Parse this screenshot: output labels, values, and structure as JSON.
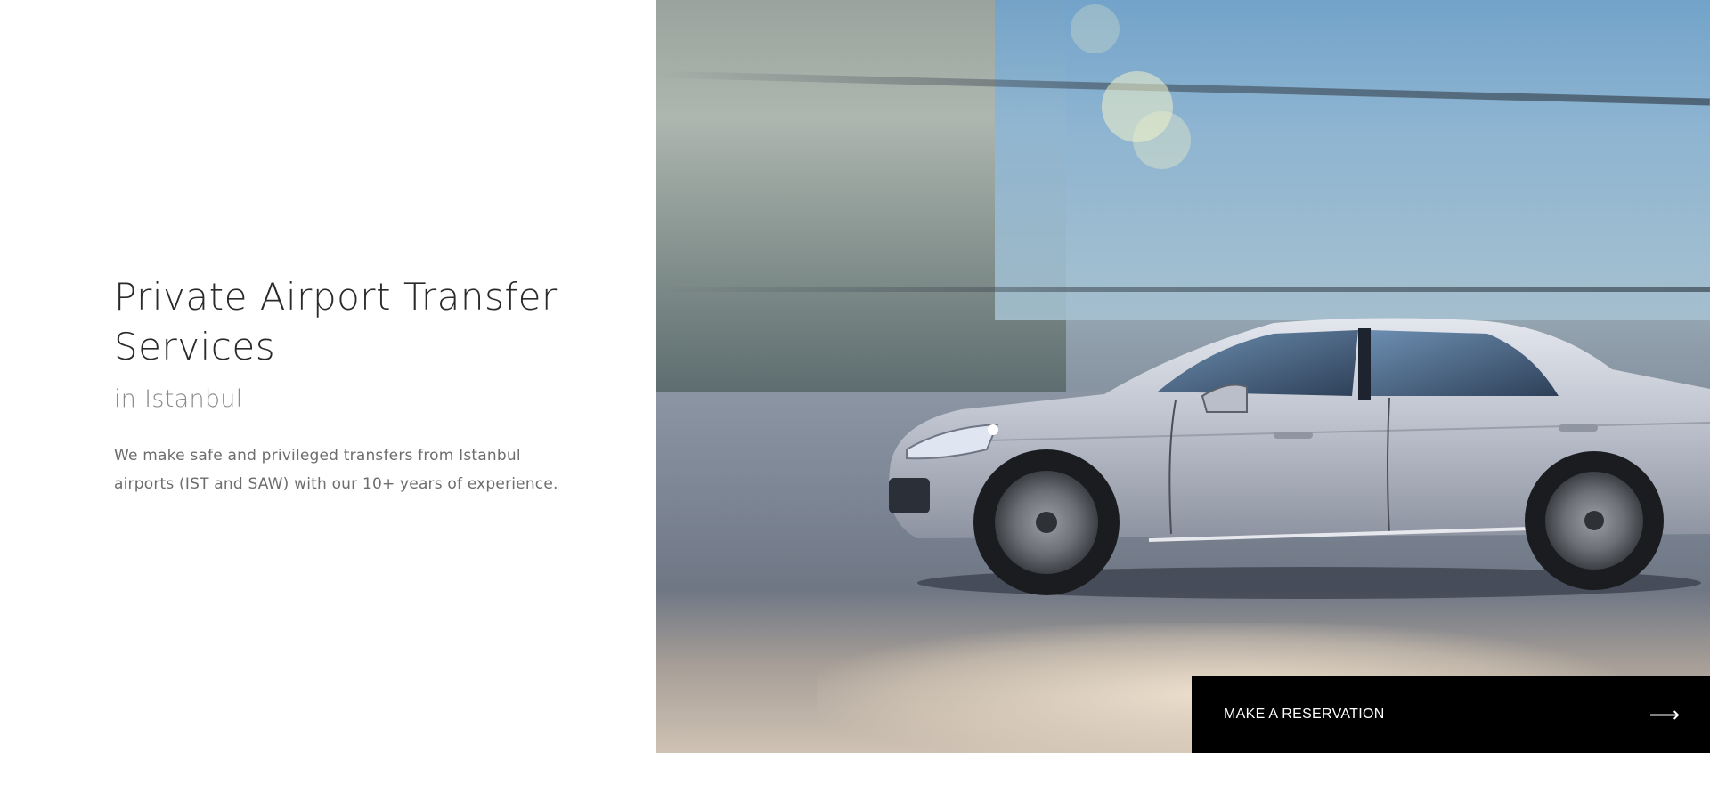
{
  "hero": {
    "title": "Private Airport Transfer Services",
    "subtitle": "in Istanbul",
    "description": "We make safe and privileged transfers from Istanbul airports (IST and SAW) with our 10+ years of experience."
  },
  "image": {
    "subject": "silver-sedan-car-photo"
  },
  "cta": {
    "label": "MAKE A RESERVATION",
    "icon": "arrow-right-icon",
    "arrow_glyph": "⟶",
    "background_color": "#000000",
    "text_color": "#ffffff"
  },
  "colors": {
    "title": "#2a2a2a",
    "subtitle": "#8a8a8a",
    "body_text": "#6d6d6d"
  }
}
